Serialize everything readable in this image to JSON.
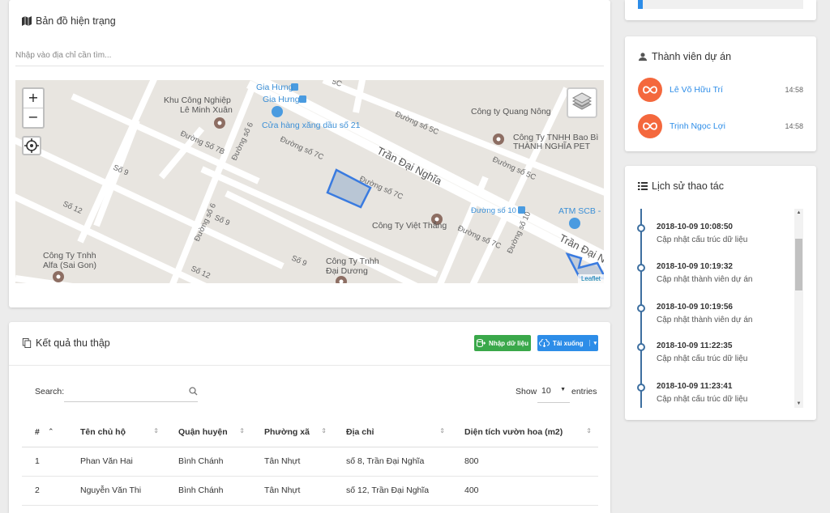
{
  "map_card": {
    "title": "Bản đồ hiện trạng",
    "search_placeholder": "Nhập vào địa chỉ cần tìm...",
    "zoom_in": "+",
    "zoom_out": "−",
    "attribution": "Leaflet",
    "labels": {
      "gia_hung_1": "Gia Hưng",
      "gia_hung_2": "Gia Hưng",
      "kcn_1": "Khu Công Nghiệp",
      "kcn_2": "Lê Minh Xuân",
      "gas_station": "Cửa hàng xăng dầu số 21",
      "quang_nong": "Công ty Quang Nông",
      "bao_bi_1": "Công Ty TNHH Bao Bì",
      "bao_bi_2": "THÀNH NGHĨA PET",
      "duong_5c_top": "5C",
      "duong_so_5c": "Đường số 5C",
      "duong_so_5c_b": "Đường số 5C",
      "duong_so_7c": "Đường số 7C",
      "duong_so_7c_b": "Đường số 7C",
      "duong_so_7c_c": "Đường số 7C",
      "duong_so_7b": "Đường Số 7B",
      "duong_so_6": "Đường số 6",
      "duong_so_6_b": "Đường số 6",
      "tran_dai_nghia": "Trần Đại Nghĩa",
      "tran_dai_nghia_b": "Trần Đại Ng",
      "so_9": "Số 9",
      "so_9_b": "Số 9",
      "so_9_c": "Số 9",
      "so_12": "Số 12",
      "so_12_b": "Số 12",
      "duong_so_10": "Đường số 10",
      "duong_so_10_b": "Đường số 10",
      "atm": "ATM SCB -",
      "viet_thang": "Công Ty Việt Thắng",
      "alfa_1": "Công Ty Tnhh",
      "alfa_2": "Alfa (Sai Gon)",
      "dai_duong_1": "Công Ty Tnhh",
      "dai_duong_2": "Đại Dương",
      "duong_so_10_road": "Đường số 10"
    }
  },
  "results_card": {
    "title": "Kết quả thu thập",
    "import_button": "Nhập dữ liệu",
    "download_button": "Tải xuống",
    "search_label": "Search:",
    "show_label": "Show",
    "entries_value": "10",
    "entries_label": "entries",
    "columns": [
      "#",
      "Tên chủ hộ",
      "Quận huyện",
      "Phường xã",
      "Địa chỉ",
      "Diện tích vườn hoa (m2)"
    ],
    "rows": [
      [
        "1",
        "Phan Văn Hai",
        "Bình Chánh",
        "Tân Nhựt",
        "số 8, Trần Đại Nghĩa",
        "800"
      ],
      [
        "2",
        "Nguyễn Văn Thi",
        "Bình Chánh",
        "Tân Nhựt",
        "số 12, Trần Đại Nghĩa",
        "400"
      ]
    ]
  },
  "progress": {
    "value": 0.03,
    "color": "#2d8de8"
  },
  "members_card": {
    "title": "Thành viên dự án",
    "members": [
      {
        "name": "Lê Võ Hữu Trí",
        "time": "14:58"
      },
      {
        "name": "Trịnh Ngọc Lợi",
        "time": "14:58"
      }
    ]
  },
  "history_card": {
    "title": "Lịch sử thao tác",
    "events": [
      {
        "time": "2018-10-09 10:08:50",
        "desc": "Cập nhật cấu trúc dữ liệu"
      },
      {
        "time": "2018-10-09 10:19:32",
        "desc": "Cập nhật thành viên dự án"
      },
      {
        "time": "2018-10-09 10:19:56",
        "desc": "Cập nhật thành viên dự án"
      },
      {
        "time": "2018-10-09 11:22:35",
        "desc": "Cập nhật cấu trúc dữ liệu"
      },
      {
        "time": "2018-10-09 11:23:41",
        "desc": "Cập nhật cấu trúc dữ liệu"
      }
    ]
  },
  "colors": {
    "accent": "#2d8de8",
    "success": "#3aa84a",
    "avatar": "#f4683d",
    "polygon": "#3a7be0"
  }
}
